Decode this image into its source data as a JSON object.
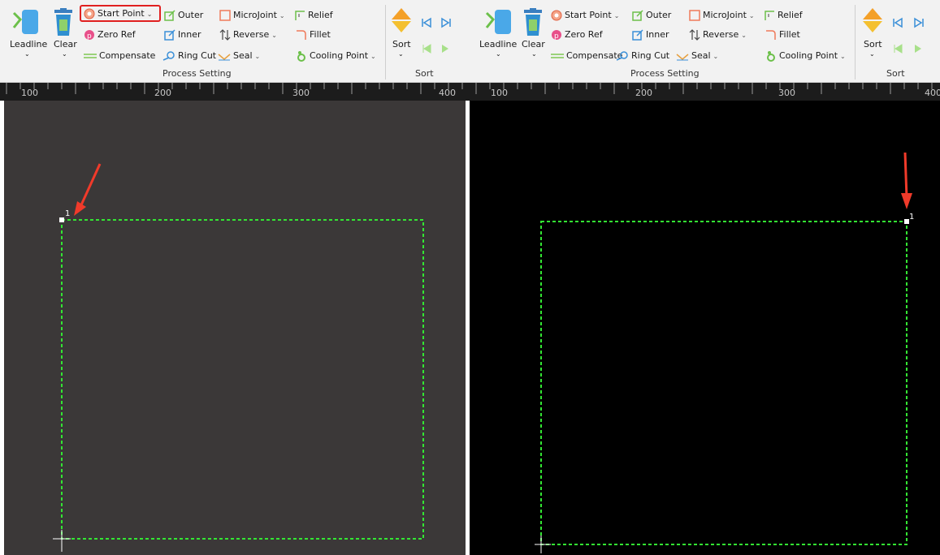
{
  "panels": [
    {
      "ribbon": {
        "leadline_label": "Leadline",
        "clear_label": "Clear",
        "start_point_label": "Start Point",
        "zero_ref_label": "Zero Ref",
        "compensate_label": "Compensate",
        "outer_label": "Outer",
        "inner_label": "Inner",
        "ring_cut_label": "Ring Cut",
        "microjoint_label": "MicroJoint",
        "reverse_label": "Reverse",
        "seal_label": "Seal",
        "relief_label": "Relief",
        "fillet_label": "Fillet",
        "cooling_point_label": "Cooling Point",
        "process_setting_label": "Process Setting",
        "sort_label": "Sort",
        "sort_group_label": "Sort"
      },
      "ruler": {
        "ticks": [
          "100",
          "200",
          "300",
          "400"
        ]
      },
      "start_point_number": "1"
    },
    {
      "ribbon": {
        "leadline_label": "Leadline",
        "clear_label": "Clear",
        "start_point_label": "Start Point",
        "zero_ref_label": "Zero Ref",
        "compensate_label": "Compensate",
        "outer_label": "Outer",
        "inner_label": "Inner",
        "ring_cut_label": "Ring Cut",
        "microjoint_label": "MicroJoint",
        "reverse_label": "Reverse",
        "seal_label": "Seal",
        "relief_label": "Relief",
        "fillet_label": "Fillet",
        "cooling_point_label": "Cooling Point",
        "process_setting_label": "Process Setting",
        "sort_label": "Sort",
        "sort_group_label": "Sort"
      },
      "ruler": {
        "ticks": [
          "100",
          "200",
          "300",
          "400"
        ]
      },
      "start_point_number": "1"
    }
  ],
  "colors": {
    "path": "#33e633",
    "arrow": "#f03a2a",
    "highlight": "#e02020",
    "canvas_left": "#3b3838",
    "canvas_right": "#000000"
  }
}
